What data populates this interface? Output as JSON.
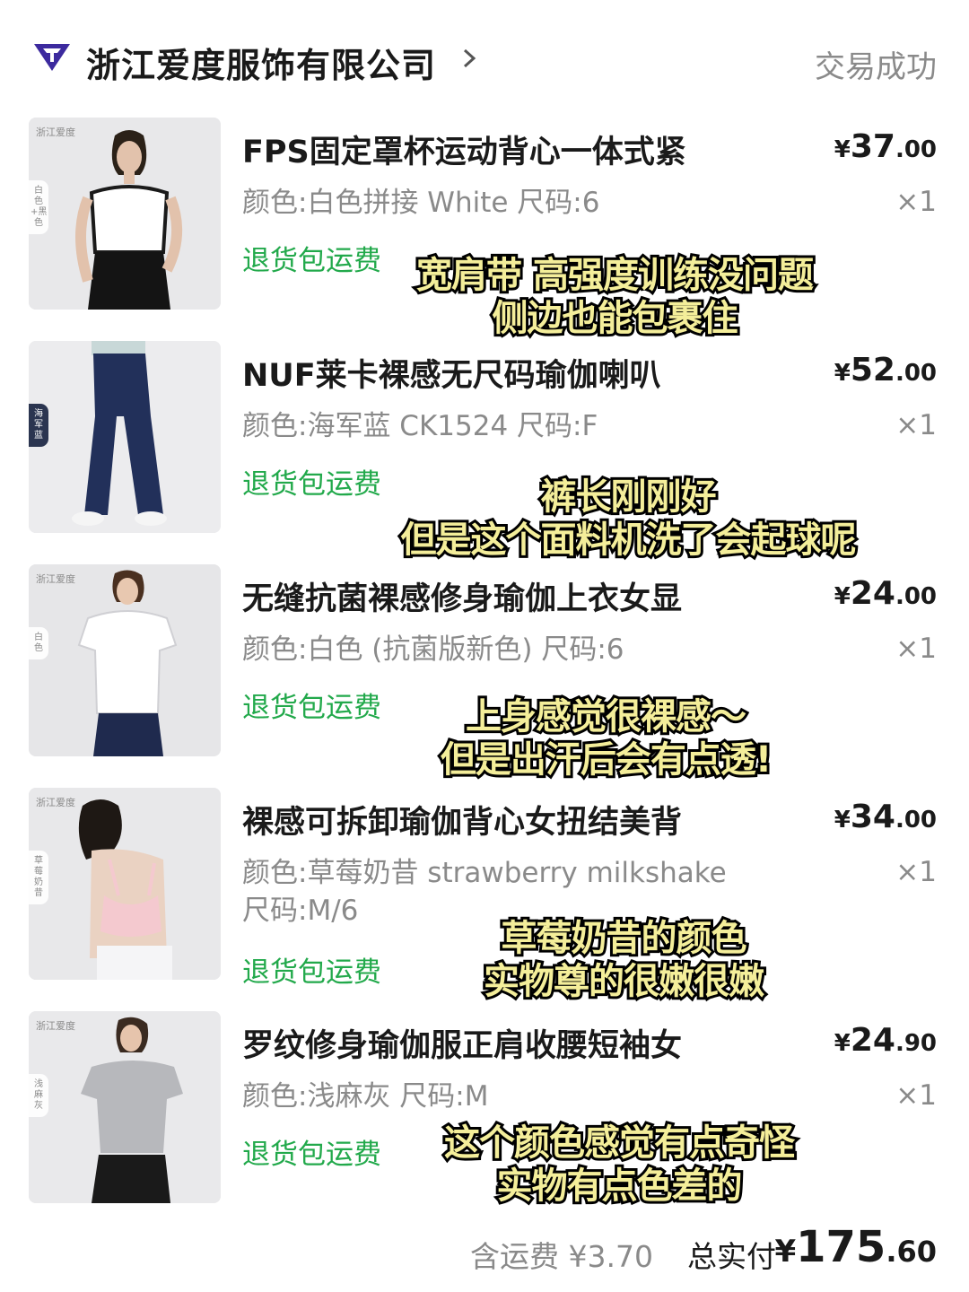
{
  "header": {
    "shop_name": "浙江爱度服饰有限公司",
    "status": "交易成功",
    "logo_icon": "diamond-logo-icon",
    "chevron_icon": "chevron-right-icon",
    "logo_color": "#3c2a9e"
  },
  "items": [
    {
      "title": "FPS固定罩杯运动背心一体式紧",
      "price_currency": "¥",
      "price_int": "37",
      "price_dec": ".00",
      "spec": "颜色:白色拼接 White 尺码:6",
      "qty": "×1",
      "service": "退货包运费",
      "thumb_brand": "浙江爱度",
      "thumb_tag": "白色+黑色",
      "caption_line1": "宽肩带 高强度训练没问题",
      "caption_line2": "侧边也能包裹住"
    },
    {
      "title": "NUF莱卡裸感无尺码瑜伽喇叭",
      "price_currency": "¥",
      "price_int": "52",
      "price_dec": ".00",
      "spec": "颜色:海军蓝  CK1524 尺码:F",
      "qty": "×1",
      "service": "退货包运费",
      "thumb_brand": "",
      "thumb_tag": "海军蓝",
      "caption_line1": "裤长刚刚好",
      "caption_line2": "但是这个面料机洗了会起球呢"
    },
    {
      "title": "无缝抗菌裸感修身瑜伽上衣女显",
      "price_currency": "¥",
      "price_int": "24",
      "price_dec": ".00",
      "spec": "颜色:白色 (抗菌版新色) 尺码:6",
      "qty": "×1",
      "service": "退货包运费",
      "thumb_brand": "浙江爱度",
      "thumb_tag": "白色",
      "caption_line1": "上身感觉很裸感～",
      "caption_line2": "但是出汗后会有点透!"
    },
    {
      "title": "裸感可拆卸瑜伽背心女扭结美背",
      "price_currency": "¥",
      "price_int": "34",
      "price_dec": ".00",
      "spec": "颜色:草莓奶昔 strawberry milkshake 尺码:M/6",
      "qty": "×1",
      "service": "退货包运费",
      "thumb_brand": "浙江爱度",
      "thumb_tag": "草莓奶昔",
      "caption_line1": "草莓奶昔的颜色",
      "caption_line2": "实物尊的很嫩很嫩"
    },
    {
      "title": "罗纹修身瑜伽服正肩收腰短袖女",
      "price_currency": "¥",
      "price_int": "24",
      "price_dec": ".90",
      "spec": "颜色:浅麻灰 尺码:M",
      "qty": "×1",
      "service": "退货包运费",
      "thumb_brand": "浙江爱度",
      "thumb_tag": "浅麻灰",
      "caption_line1": "这个颜色感觉有点奇怪",
      "caption_line2": "实物有点色差的"
    }
  ],
  "footer": {
    "shipping": "含运费 ¥3.70",
    "total_label": "总实付",
    "total_currency": "¥",
    "total_int": "175",
    "total_dec": ".60"
  },
  "colors": {
    "service_green": "#22a94b",
    "caption_fill": "#f4ee9a",
    "caption_stroke": "#000000",
    "muted_text": "#8a8a8a"
  }
}
